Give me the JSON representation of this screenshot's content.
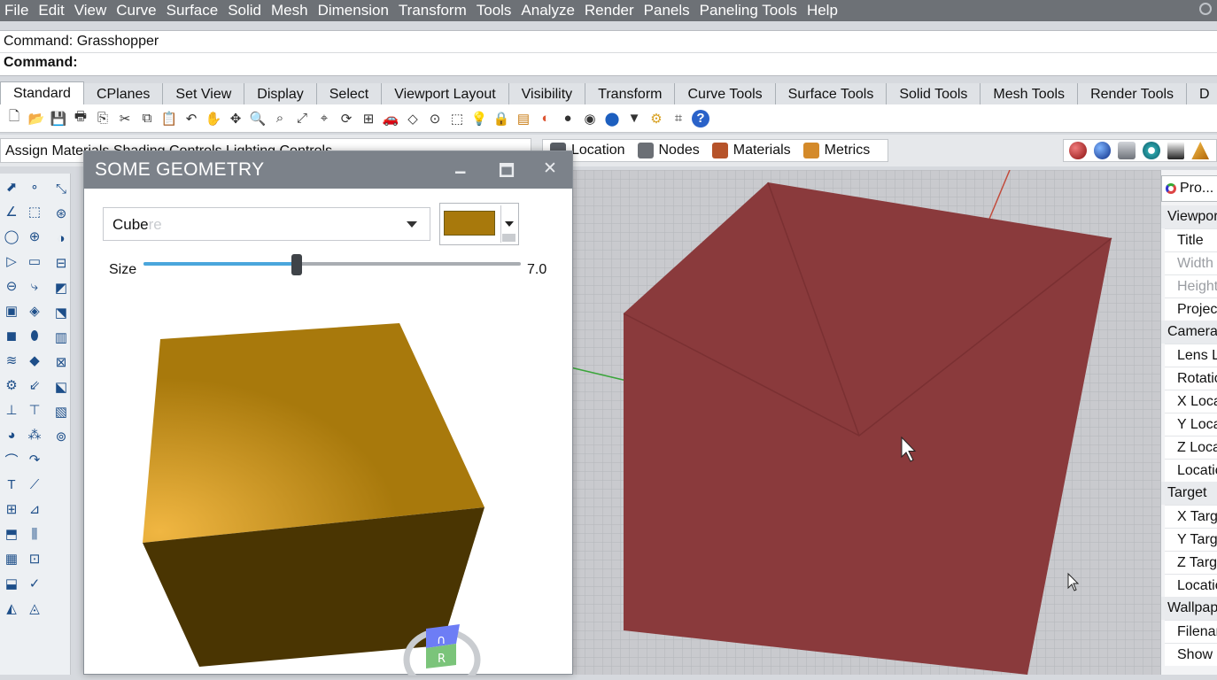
{
  "menu": [
    "File",
    "Edit",
    "View",
    "Curve",
    "Surface",
    "Solid",
    "Mesh",
    "Dimension",
    "Transform",
    "Tools",
    "Analyze",
    "Render",
    "Panels",
    "Paneling Tools",
    "Help"
  ],
  "command": {
    "history": "Command: Grasshopper",
    "prompt": "Command:"
  },
  "tabs": [
    "Standard",
    "CPlanes",
    "Set View",
    "Display",
    "Select",
    "Viewport Layout",
    "Visibility",
    "Transform",
    "Curve Tools",
    "Surface Tools",
    "Solid Tools",
    "Mesh Tools",
    "Render Tools",
    "D"
  ],
  "toolbar_row3": {
    "left_text": "Assign Materials  Shading Controls  Lighting Controls",
    "right_tools": [
      {
        "label": "Location",
        "icon": "globe-icon",
        "color": "#5a5f66"
      },
      {
        "label": "Nodes",
        "icon": "nodes-icon",
        "color": "#6b6f75"
      },
      {
        "label": "Materials",
        "icon": "materials-icon",
        "color": "#b6532a"
      },
      {
        "label": "Metrics",
        "icon": "metrics-icon",
        "color": "#d48a2a"
      }
    ]
  },
  "dialog": {
    "title": "SOME GEOMETRY",
    "minimize": "🗕",
    "maximize": "🗖",
    "close": "✕",
    "shape": {
      "value": "Cube",
      "ghost": "re"
    },
    "color": "#a8790c",
    "size": {
      "label": "Size",
      "value": "7.0",
      "fraction": 0.405
    }
  },
  "navcube": {
    "top": "∩",
    "front": "R"
  },
  "right_panel": {
    "tab": "Pro...",
    "rows": [
      {
        "t": "hdr",
        "label": "Viewport"
      },
      {
        "t": "row",
        "label": "Title"
      },
      {
        "t": "row",
        "label": "Width",
        "grey": true
      },
      {
        "t": "row",
        "label": "Height",
        "grey": true
      },
      {
        "t": "row",
        "label": "Projection"
      },
      {
        "t": "hdr",
        "label": "Camera"
      },
      {
        "t": "row",
        "label": "Lens Length"
      },
      {
        "t": "row",
        "label": "Rotation"
      },
      {
        "t": "row",
        "label": "X Location"
      },
      {
        "t": "row",
        "label": "Y Location"
      },
      {
        "t": "row",
        "label": "Z Location"
      },
      {
        "t": "row",
        "label": "Location"
      },
      {
        "t": "hdr",
        "label": "Target"
      },
      {
        "t": "row",
        "label": "X Target"
      },
      {
        "t": "row",
        "label": "Y Target"
      },
      {
        "t": "row",
        "label": "Z Target"
      },
      {
        "t": "row",
        "label": "Location"
      },
      {
        "t": "hdr",
        "label": "Wallpaper"
      },
      {
        "t": "row",
        "label": "Filename"
      },
      {
        "t": "row",
        "label": "Show"
      }
    ]
  },
  "colors": {
    "menubar": "#6d7176",
    "viewport_box": "#8a3a3c",
    "cube_top": "#a8790c",
    "cube_front": "#4a3502"
  }
}
